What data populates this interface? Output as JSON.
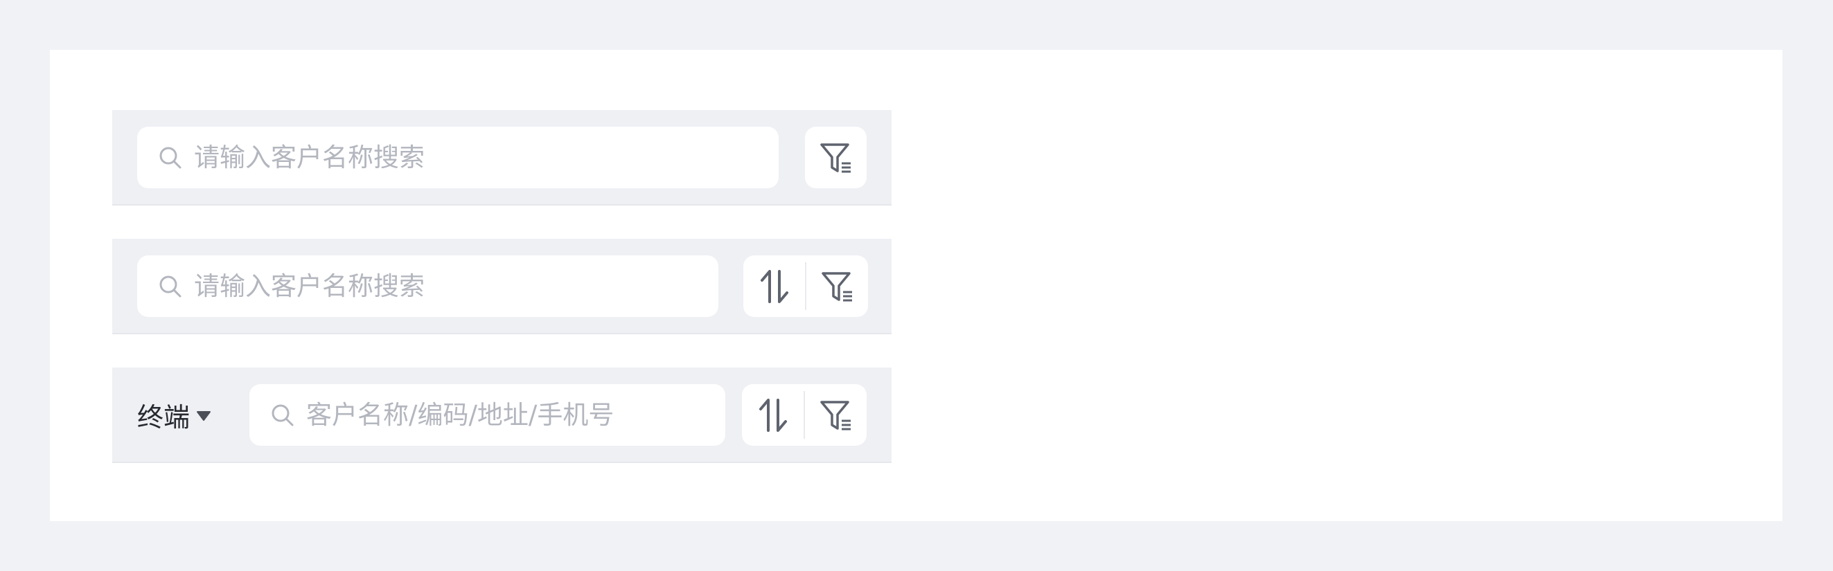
{
  "bar1": {
    "search_placeholder": "请输入客户名称搜索"
  },
  "bar2": {
    "search_placeholder": "请输入客户名称搜索"
  },
  "bar3": {
    "dropdown_label": "终端",
    "search_placeholder": "客户名称/编码/地址/手机号"
  },
  "icons": {
    "search": "search-icon",
    "filter": "filter-icon",
    "sort": "sort-icon",
    "dropdown": "caret-down-icon"
  },
  "colors": {
    "page_bg": "#f1f2f6",
    "bar_bg": "#eff0f4",
    "placeholder": "#b3b6be",
    "icon": "#5e636e",
    "text": "#262a30"
  }
}
